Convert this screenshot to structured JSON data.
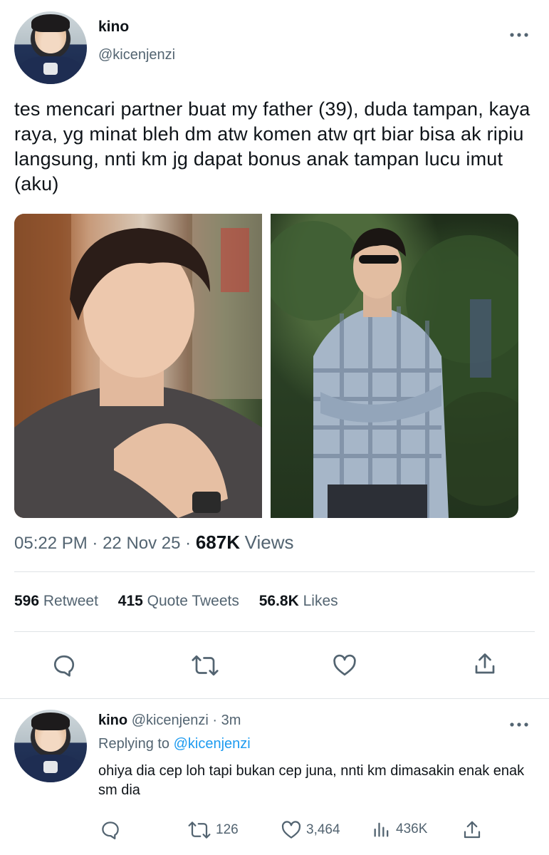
{
  "tweet": {
    "author_name": "kino",
    "author_handle": "@kicenjenzi",
    "more_icon": "more-horizontal-icon",
    "text": "tes mencari partner buat my father (39), duda tampan, kaya raya, yg minat bleh dm atw komen atw qrt biar bisa ak ripiu langsung, nnti km jg dapat bonus anak tampan lucu imut (aku)",
    "time": "05:22 PM",
    "separator": "·",
    "date": "22 Nov 25",
    "views_count": "687K",
    "views_label": "Views",
    "stats": {
      "retweets_count": "596",
      "retweets_label": "Retweet",
      "quotes_count": "415",
      "quotes_label": "Quote Tweets",
      "likes_count": "56.8K",
      "likes_label": "Likes"
    },
    "actions": [
      "reply-icon",
      "retweet-icon",
      "like-icon",
      "share-icon"
    ]
  },
  "reply": {
    "author_name": "kino",
    "author_handle": "@kicenjenzi",
    "time_ago": "· 3m",
    "replying_prefix": "Replying to",
    "replying_to": "@kicenjenzi",
    "text": "ohiya dia cep loh tapi bukan cep juna, nnti km dimasakin enak enak sm dia",
    "retweet_count": "126",
    "like_count": "3,464",
    "views_count": "436K"
  },
  "colors": {
    "text_primary": "#0f1419",
    "text_secondary": "#536471",
    "link": "#1d9bf0",
    "divider": "#dfe3e6"
  }
}
